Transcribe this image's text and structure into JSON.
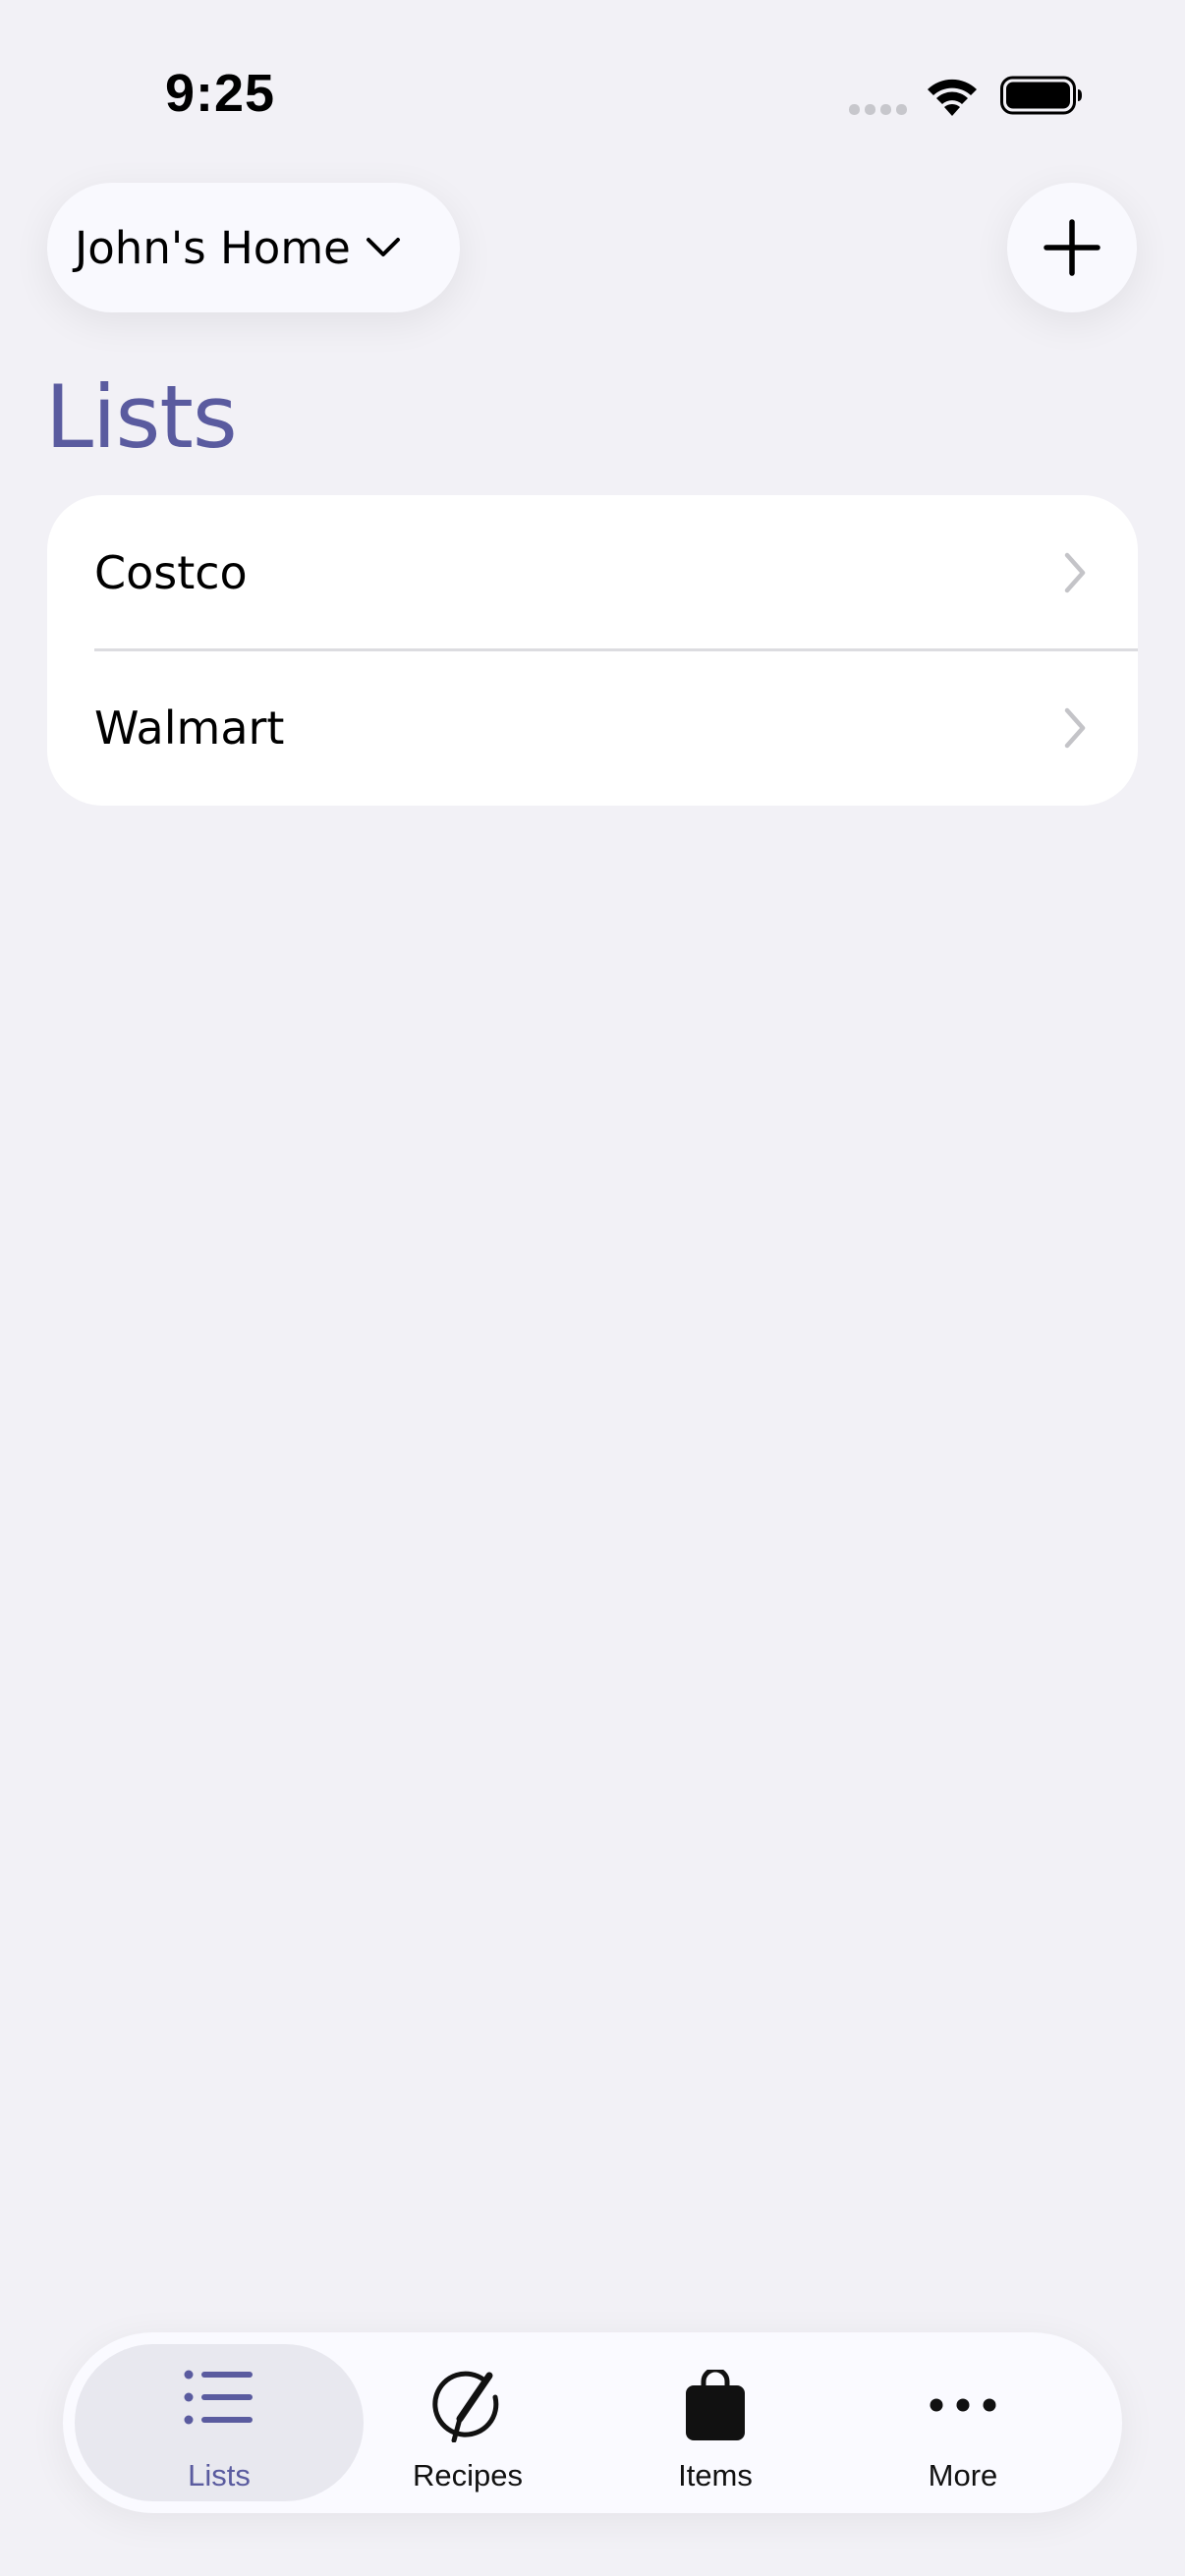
{
  "status_bar": {
    "time": "9:25"
  },
  "header": {
    "home_selector_label": "John's Home"
  },
  "page": {
    "title": "Lists"
  },
  "lists": [
    {
      "label": "Costco"
    },
    {
      "label": "Walmart"
    }
  ],
  "tab_bar": {
    "tabs": [
      {
        "label": "Lists",
        "icon": "list-icon",
        "selected": true
      },
      {
        "label": "Recipes",
        "icon": "pencil-circle-icon",
        "selected": false
      },
      {
        "label": "Items",
        "icon": "bag-icon",
        "selected": false
      },
      {
        "label": "More",
        "icon": "ellipsis-icon",
        "selected": false
      }
    ]
  },
  "colors": {
    "accent": "#5a5b9f",
    "background": "#f2f1f6",
    "card": "#ffffff"
  }
}
